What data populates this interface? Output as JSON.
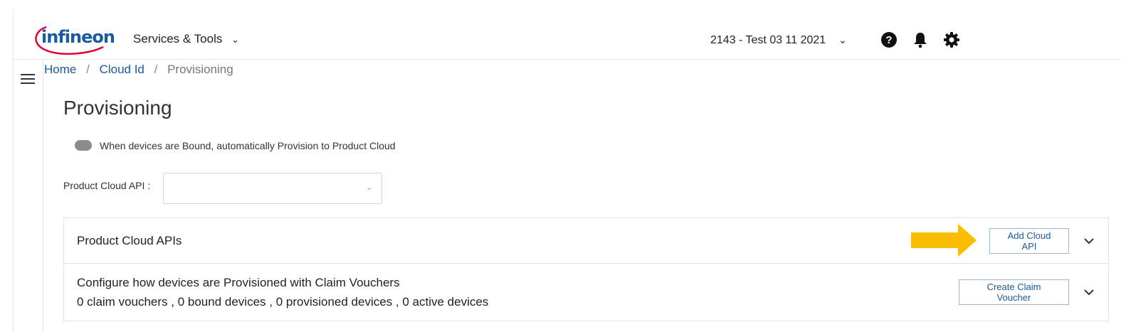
{
  "header": {
    "logo_text": "infineon",
    "services_menu": "Services & Tools",
    "tenant_selector": "2143 - Test 03 11 2021",
    "icons": [
      "help-icon",
      "bell-icon",
      "gear-icon"
    ]
  },
  "breadcrumb": {
    "home": "Home",
    "cloud_id": "Cloud Id",
    "current": "Provisioning",
    "separator": "/"
  },
  "page": {
    "title": "Provisioning",
    "auto_provision_label": "When devices are Bound, automatically Provision to Product Cloud",
    "auto_provision_enabled": false,
    "product_cloud_api_label": "Product Cloud API :",
    "product_cloud_api_value": ""
  },
  "panels": {
    "cloud_apis": {
      "title": "Product Cloud APIs",
      "button": "Add Cloud API"
    },
    "claim_vouchers": {
      "title": "Configure how devices are Provisioned with Claim Vouchers",
      "summary": "0 claim vouchers , 0 bound devices , 0 provisioned devices , 0 active devices",
      "button": "Create Claim Voucher"
    }
  },
  "colors": {
    "accent_blue": "#1a5aa0",
    "logo_red": "#e30034",
    "annotation_arrow": "#fbbd04",
    "toggle_off": "#8c8c8c"
  }
}
